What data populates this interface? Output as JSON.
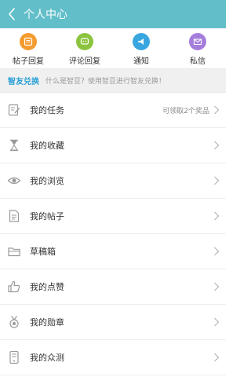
{
  "header": {
    "title": "个人中心"
  },
  "shortcuts": [
    {
      "label": "帖子回复",
      "color": "#f49b2e",
      "icon": "post-reply-icon"
    },
    {
      "label": "评论回复",
      "color": "#8cc43f",
      "icon": "comment-reply-icon"
    },
    {
      "label": "通知",
      "color": "#3aa6e0",
      "icon": "notification-icon"
    },
    {
      "label": "私信",
      "color": "#a57ddb",
      "icon": "message-icon"
    }
  ],
  "banner": {
    "title": "智友兑换",
    "desc": "什么是智豆？使用智豆进行智友兑换！"
  },
  "menu": [
    {
      "label": "我的任务",
      "extra": "可领取2个奖品",
      "icon": "task-icon"
    },
    {
      "label": "我的收藏",
      "extra": "",
      "icon": "hourglass-icon"
    },
    {
      "label": "我的浏览",
      "extra": "",
      "icon": "eye-icon"
    },
    {
      "label": "我的帖子",
      "extra": "",
      "icon": "document-icon"
    },
    {
      "label": "草稿箱",
      "extra": "",
      "icon": "folder-icon"
    },
    {
      "label": "我的点赞",
      "extra": "",
      "icon": "thumbs-up-icon"
    },
    {
      "label": "我的勋章",
      "extra": "",
      "icon": "medal-icon"
    },
    {
      "label": "我的众测",
      "extra": "",
      "icon": "phone-test-icon"
    }
  ]
}
